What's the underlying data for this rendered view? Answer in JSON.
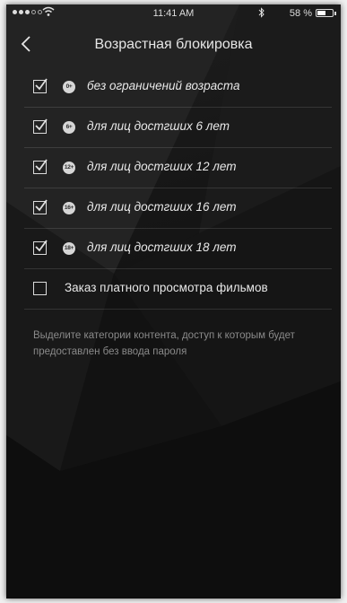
{
  "status_bar": {
    "time": "11:41 AM",
    "battery_text": "58 %",
    "battery_level": 0.58
  },
  "nav": {
    "title": "Возрастная блокировка"
  },
  "items": [
    {
      "badge": "0+",
      "label": "без ограничений возраста",
      "checked": true
    },
    {
      "badge": "6+",
      "label": "для лиц достгших 6 лет",
      "checked": true
    },
    {
      "badge": "12+",
      "label": "для лиц достгших 12 лет",
      "checked": true
    },
    {
      "badge": "16+",
      "label": "для лиц достгших 16 лет",
      "checked": true
    },
    {
      "badge": "18+",
      "label": "для лиц достгших 18 лет",
      "checked": true
    }
  ],
  "paid_option": {
    "label": "Заказ платного просмотра фильмов",
    "checked": false
  },
  "hint": "Выделите категории контента, доступ к которым будет предоставлен без ввода пароля"
}
